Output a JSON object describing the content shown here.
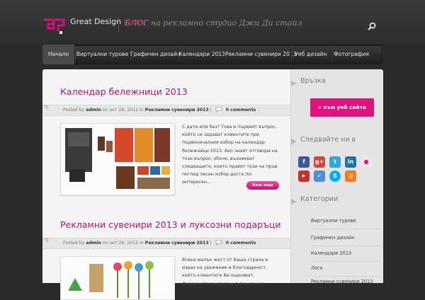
{
  "header": {
    "logo_text": "Great Design",
    "logo_accent": "ideas",
    "tagline": "БЛОГ на рекламно студио Джи Ди стайл"
  },
  "nav": {
    "items": [
      {
        "label": "Начало",
        "active": true
      },
      {
        "label": "Виртуални турове"
      },
      {
        "label": "Графичен дизайн"
      },
      {
        "label": "Календари 2013"
      },
      {
        "label": "Рекламни сувенири 2013"
      },
      {
        "label": "Уеб дизайн"
      },
      {
        "label": "Фотография"
      }
    ]
  },
  "posts": [
    {
      "title": "Календар бележници 2013",
      "posted_by": "Posted by",
      "author": "admin",
      "on": "on окт 28, 2012 in",
      "category": "Рекламни сувенири 2013",
      "comments": "0 comments",
      "excerpt": "С дати или без? Това е първият въпрос, който си задават клиентите при първоначалния избор на календар бележници 2013. Ако знаят отговора на този въпрос, обаче, възникват следващите, които правят този на пръв поглед лесен избор доста по-интересен...",
      "more": "Виж още"
    },
    {
      "title": "Рекламни сувенири 2013 и луксозни подаръци",
      "posted_by": "Posted by",
      "author": "admin",
      "on": "on окт 26, 2012 in",
      "category": "Рекламни сувенири 2013",
      "comments": "0 comments",
      "excerpt": "Всеки малък жест от Ваша страна е израз на уважение и благодарност, който клиентите Ви оценяват. Фирмените рекламни сувенири са"
    }
  ],
  "sidebar": {
    "contact_title": "Връзка",
    "to_site": "» към уеб сайта",
    "follow_title": "Следвайте ни в",
    "categories_title": "Категории",
    "categories": [
      "Виртуални турове",
      "Графичен дизайн",
      "Календари 2013",
      "Лого",
      "Рекламни сувенири 2013"
    ],
    "social": [
      {
        "icon": "facebook-icon",
        "glyph": "f",
        "color": "#3b5998"
      },
      {
        "icon": "google-icon",
        "glyph": "g+",
        "color": "#d34836"
      },
      {
        "icon": "twitter-icon",
        "glyph": "t",
        "color": "#2fa7df"
      },
      {
        "icon": "linkedin-icon",
        "glyph": "in",
        "color": "#1b75a6"
      },
      {
        "icon": "flickr-icon",
        "glyph": "●",
        "color": "#e8e8e8"
      },
      {
        "icon": "youtube-icon",
        "glyph": "▶",
        "color": "#c4302b"
      },
      {
        "icon": "delicious-icon",
        "glyph": "✓",
        "color": "#4e8fd6"
      },
      {
        "icon": "skype-icon",
        "glyph": "S",
        "color": "#00aff0"
      },
      {
        "icon": "rss-icon",
        "glyph": "))",
        "color": "#f57b1f"
      }
    ]
  },
  "colors": {
    "accent": "#d60f7e",
    "title": "#b0136f"
  }
}
